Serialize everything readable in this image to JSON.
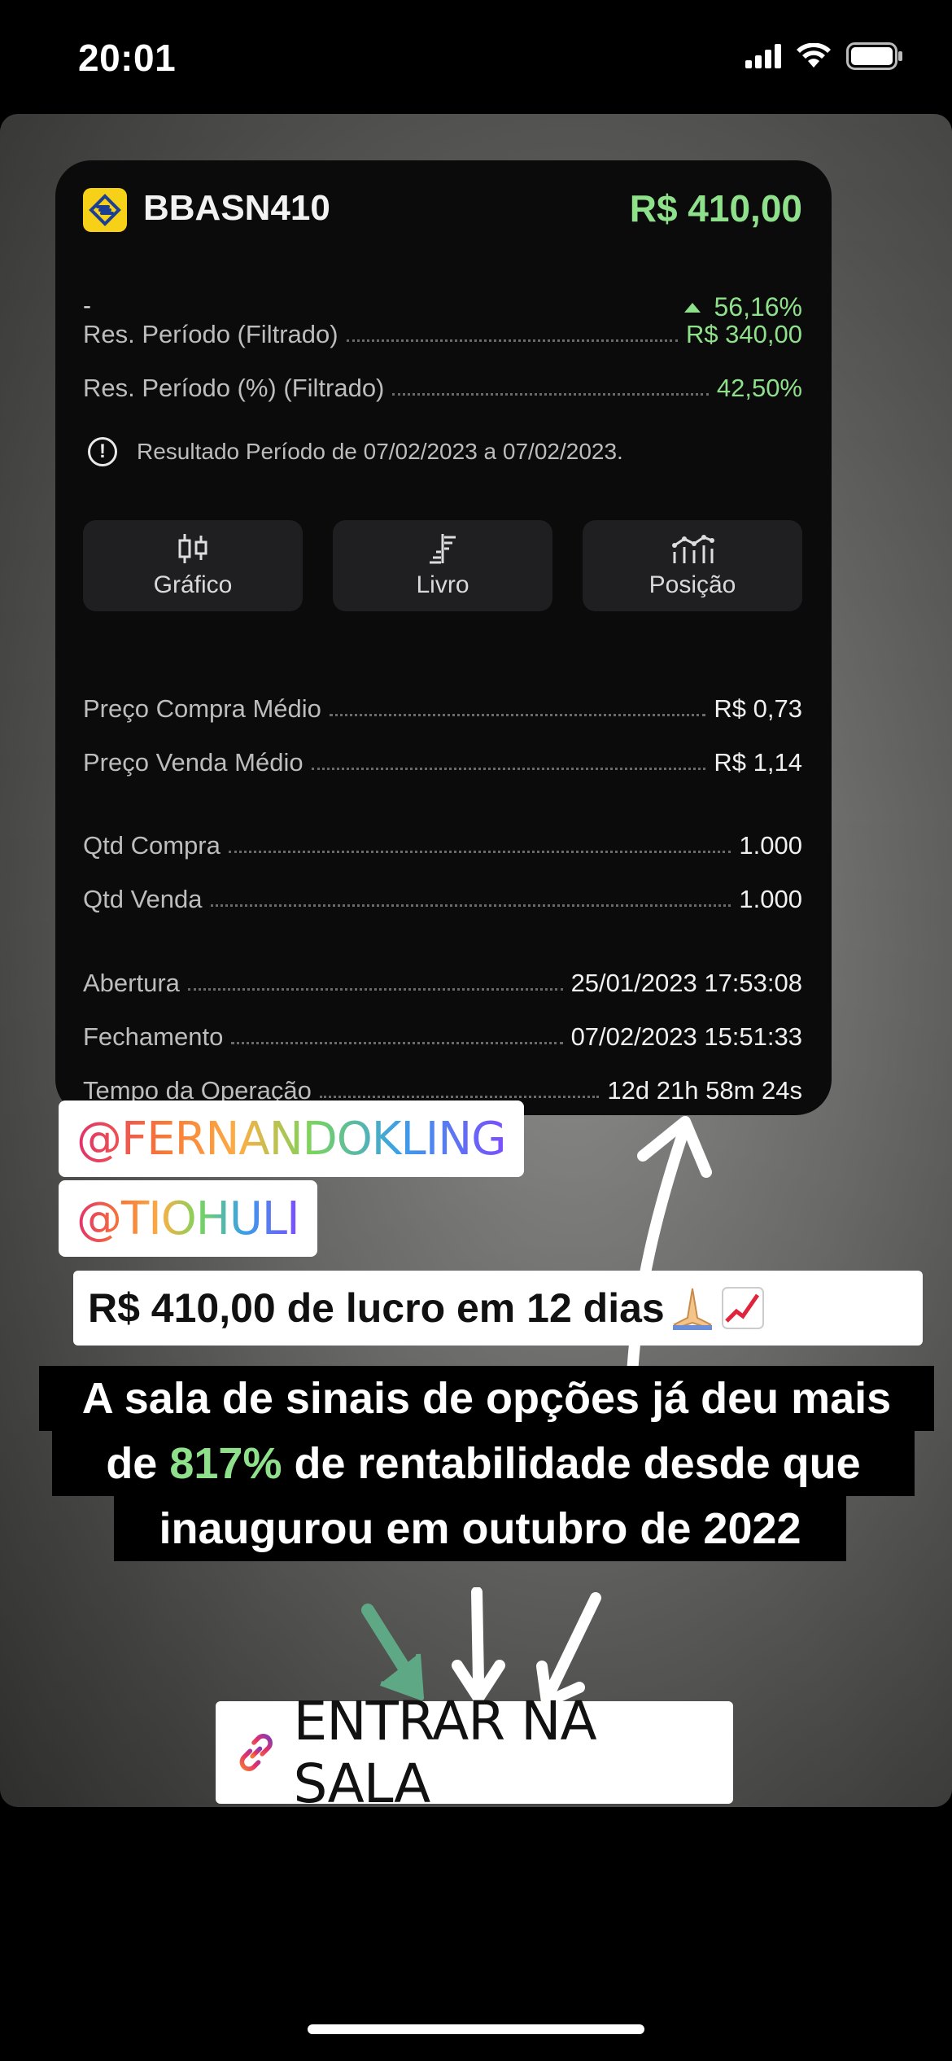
{
  "status_bar": {
    "time": "20:01"
  },
  "card": {
    "ticker": "BBASN410",
    "price": "R$ 410,00",
    "subtitle": "-",
    "change": "56,16%",
    "results": [
      {
        "label": "Res. Período (Filtrado)",
        "value": "R$ 340,00"
      },
      {
        "label": "Res. Período (%) (Filtrado)",
        "value": "42,50%"
      }
    ],
    "info_text": "Resultado Período de 07/02/2023 a 07/02/2023.",
    "actions": [
      {
        "label": "Gráfico",
        "icon": "candlestick-icon"
      },
      {
        "label": "Livro",
        "icon": "order-book-icon"
      },
      {
        "label": "Posição",
        "icon": "position-chart-icon"
      }
    ],
    "details": [
      {
        "label": "Preço Compra Médio",
        "value": "R$ 0,73"
      },
      {
        "label": "Preço Venda Médio",
        "value": "R$ 1,14"
      },
      {
        "label": "Qtd Compra",
        "value": "1.000"
      },
      {
        "label": "Qtd Venda",
        "value": "1.000"
      },
      {
        "label": "Abertura",
        "value": "25/01/2023 17:53:08"
      },
      {
        "label": "Fechamento",
        "value": "07/02/2023 15:51:33"
      },
      {
        "label": "Tempo da Operação",
        "value": "12d 21h 58m 24s"
      }
    ]
  },
  "stickers": {
    "mention_1": "@FERNANDOKLING",
    "mention_2": "@TIOHULI",
    "profit_caption": "R$ 410,00 de lucro em 12 dias",
    "promo_line_1": "A sala de sinais de opções já deu mais",
    "promo_line_2_pre": "de",
    "promo_highlight": "817%",
    "promo_line_2_post": "de rentabilidade desde que",
    "promo_line_3": "inaugurou em outubro de 2022",
    "link_label": "ENTRAR NA SALA"
  },
  "colors": {
    "gain": "#8fe08a",
    "bb_yellow": "#f7d117"
  }
}
